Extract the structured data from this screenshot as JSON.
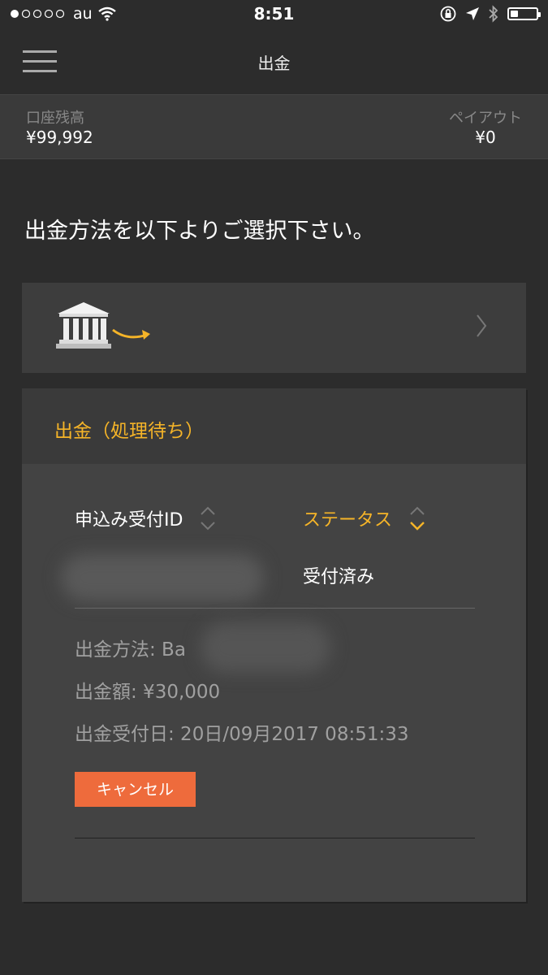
{
  "status_bar": {
    "carrier": "au",
    "time": "8:51"
  },
  "nav": {
    "title": "出金"
  },
  "balance": {
    "account_label": "口座残高",
    "account_value": "¥99,992",
    "payout_label": "ペイアウト",
    "payout_value": "¥0"
  },
  "prompt": "出金方法を以下よりご選択下さい。",
  "pending": {
    "title": "出金（処理待ち）",
    "col_id": "申込み受付ID",
    "col_status": "ステータス",
    "status_value": "受付済み",
    "method_label": "出金方法: Ba",
    "amount_label": "出金額: ¥30,000",
    "date_label": "出金受付日: 20日/09月2017 08:51:33",
    "cancel_label": "キャンセル"
  },
  "colors": {
    "accent": "#f5b428",
    "cancel": "#ee6b3c",
    "background": "#2c2c2c"
  },
  "battery_level": 0.3
}
